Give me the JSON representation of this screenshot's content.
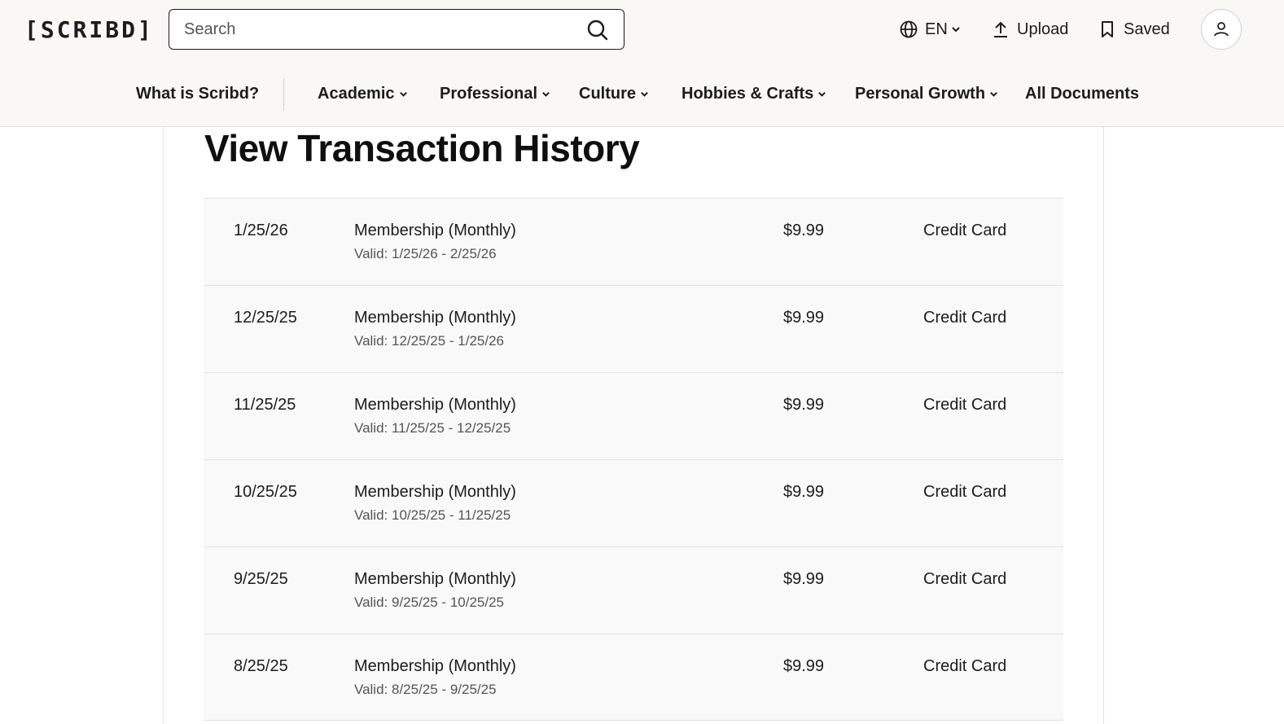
{
  "header": {
    "logo": "[SCRIBD]",
    "search": {
      "placeholder": "Search",
      "value": ""
    },
    "language": "EN",
    "upload_label": "Upload",
    "saved_label": "Saved"
  },
  "nav": {
    "items": [
      {
        "label": "What is Scribd?",
        "dropdown": false
      },
      {
        "label": "Academic",
        "dropdown": true
      },
      {
        "label": "Professional",
        "dropdown": true
      },
      {
        "label": "Culture",
        "dropdown": true
      },
      {
        "label": "Hobbies & Crafts",
        "dropdown": true
      },
      {
        "label": "Personal Growth",
        "dropdown": true
      },
      {
        "label": "All Documents",
        "dropdown": false
      }
    ]
  },
  "page": {
    "title": "View Transaction History"
  },
  "transactions": [
    {
      "date": "1/25/26",
      "description": "Membership (Monthly)",
      "valid": "Valid: 1/25/26 - 2/25/26",
      "amount": "$9.99",
      "method": "Credit Card"
    },
    {
      "date": "12/25/25",
      "description": "Membership (Monthly)",
      "valid": "Valid: 12/25/25 - 1/25/26",
      "amount": "$9.99",
      "method": "Credit Card"
    },
    {
      "date": "11/25/25",
      "description": "Membership (Monthly)",
      "valid": "Valid: 11/25/25 - 12/25/25",
      "amount": "$9.99",
      "method": "Credit Card"
    },
    {
      "date": "10/25/25",
      "description": "Membership (Monthly)",
      "valid": "Valid: 10/25/25 - 11/25/25",
      "amount": "$9.99",
      "method": "Credit Card"
    },
    {
      "date": "9/25/25",
      "description": "Membership (Monthly)",
      "valid": "Valid: 9/25/25 - 10/25/25",
      "amount": "$9.99",
      "method": "Credit Card"
    },
    {
      "date": "8/25/25",
      "description": "Membership (Monthly)",
      "valid": "Valid: 8/25/25 - 9/25/25",
      "amount": "$9.99",
      "method": "Credit Card"
    }
  ],
  "icons": {
    "search": "search-icon",
    "language": "globe-icon",
    "upload": "upload-icon",
    "saved": "bookmark-icon",
    "account": "user-icon",
    "dropdown": "chevron-down-icon"
  },
  "colors": {
    "header_bg": "#faf8f5",
    "row_bg": "#f9f9f9",
    "text": "#1c1c1c",
    "muted_text": "#545454"
  }
}
